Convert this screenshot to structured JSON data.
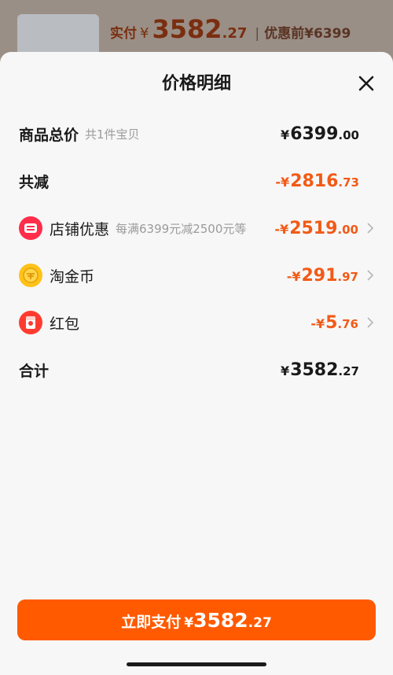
{
  "background": {
    "paid_label": "实付",
    "currency": "¥",
    "paid_int": "3582",
    "paid_dec": ".27",
    "separator": "|",
    "original_label": "优惠前",
    "original_price": "¥6399"
  },
  "sheet": {
    "title": "价格明细",
    "close_icon": "close-icon"
  },
  "rows": {
    "total": {
      "label": "商品总价",
      "sub": "共1件宝贝",
      "currency": "¥",
      "int": "6399",
      "dec": ".00"
    },
    "reduced": {
      "label": "共减",
      "prefix": "-¥",
      "int": "2816",
      "dec": ".73"
    },
    "shop": {
      "label": "店铺优惠",
      "sub": "每满6399元减2500元等",
      "prefix": "-¥",
      "int": "2519",
      "dec": ".00",
      "icon": "shop-coupon-icon",
      "icon_color": "#ff2d4a"
    },
    "coin": {
      "label": "淘金币",
      "prefix": "-¥",
      "int": "291",
      "dec": ".97",
      "icon": "gold-coin-icon",
      "icon_color": "#ffc21a"
    },
    "redpacket": {
      "label": "红包",
      "prefix": "-¥",
      "int": "5",
      "dec": ".76",
      "icon": "red-packet-icon",
      "icon_color": "#ff3b2f"
    },
    "sum": {
      "label": "合计",
      "currency": "¥",
      "int": "3582",
      "dec": ".27"
    }
  },
  "pay_button": {
    "label": "立即支付",
    "currency": "¥",
    "int": "3582",
    "dec": ".27"
  },
  "colors": {
    "accent": "#ff5a00",
    "discount": "#f25a16",
    "text": "#1a1a1a",
    "muted": "#9b9b9b"
  }
}
